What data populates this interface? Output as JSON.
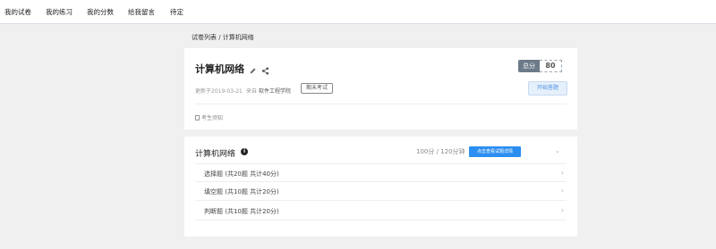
{
  "topnav": {
    "items": [
      "我的试卷",
      "我的练习",
      "我的分数",
      "给我留言",
      "待定"
    ]
  },
  "breadcrumb": "试卷列表 / 计算机网络",
  "exam": {
    "title": "计算机网络",
    "updated": "更新于2019-03-21",
    "source_label": "来自",
    "source_value": "软件工程学院",
    "tag": "期末考试",
    "score_label": "总分",
    "score_value": "80",
    "start_button": "开始答题",
    "notice": "考生须知"
  },
  "section": {
    "title": "计算机网络",
    "duration": "100分 / 120分钟",
    "detail_button": "点击查看试题详情",
    "rows": [
      {
        "label": "选择题 (共20题 共计40分)"
      },
      {
        "label": "填空题 (共10题 共计20分)"
      },
      {
        "label": "判断题 (共10题 共计20分)"
      }
    ]
  }
}
